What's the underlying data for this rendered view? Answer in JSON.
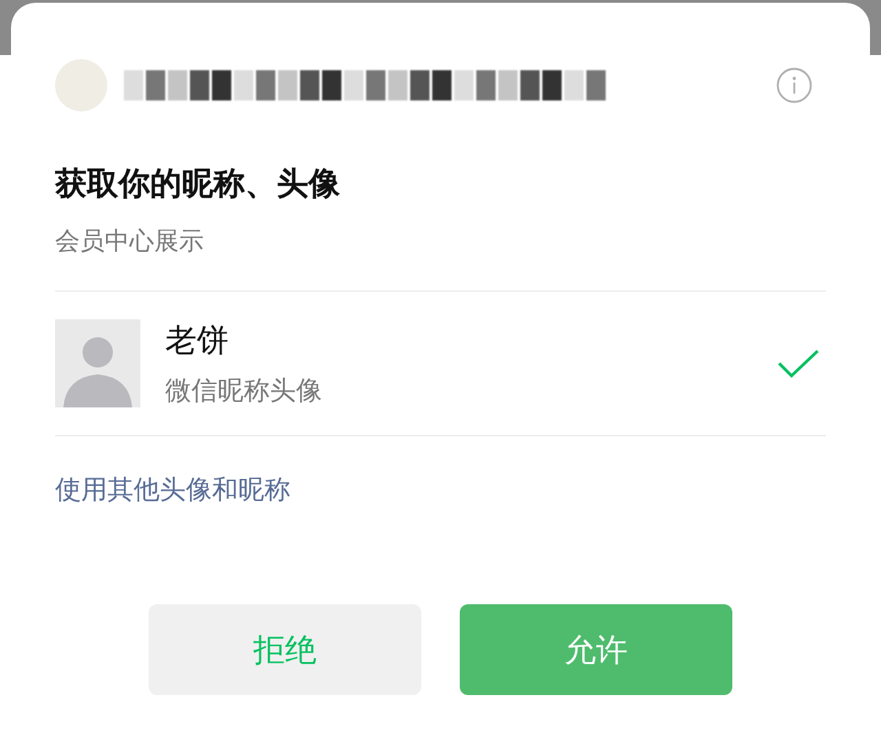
{
  "title": "获取你的昵称、头像",
  "subtitle": "会员中心展示",
  "accounts": [
    {
      "name": "老饼",
      "caption": "微信昵称头像",
      "selected": true
    }
  ],
  "other_link": "使用其他头像和昵称",
  "buttons": [
    {
      "label": "拒绝",
      "kind": "secondary"
    },
    {
      "label": "允许",
      "kind": "primary"
    }
  ]
}
